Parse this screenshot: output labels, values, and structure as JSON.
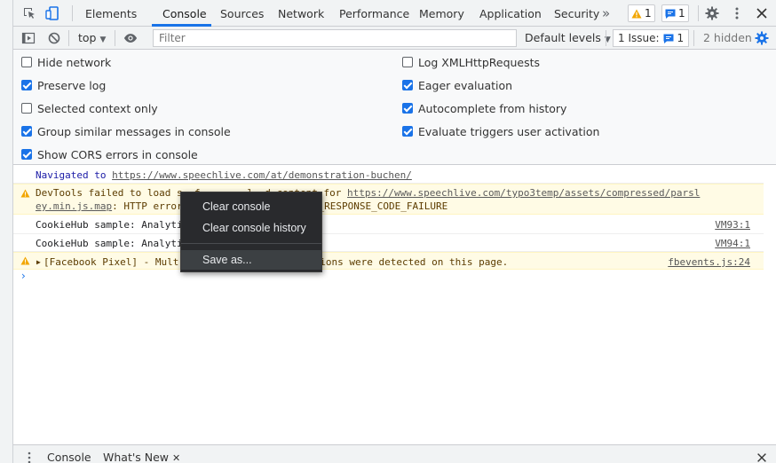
{
  "tabs": [
    {
      "label": "Elements"
    },
    {
      "label": "Console",
      "active": true
    },
    {
      "label": "Sources"
    },
    {
      "label": "Network"
    },
    {
      "label": "Performance"
    },
    {
      "label": "Memory"
    },
    {
      "label": "Application"
    },
    {
      "label": "Security"
    }
  ],
  "badges": {
    "warnings": "1",
    "messages": "1"
  },
  "toolbar": {
    "context": "top",
    "filter_placeholder": "Filter",
    "levels": "Default levels",
    "issues_label": "1 Issue:",
    "issues_count": "1",
    "hidden": "2 hidden"
  },
  "settings": {
    "left": [
      {
        "label": "Hide network",
        "checked": false
      },
      {
        "label": "Preserve log",
        "checked": true
      },
      {
        "label": "Selected context only",
        "checked": false
      },
      {
        "label": "Group similar messages in console",
        "checked": true
      },
      {
        "label": "Show CORS errors in console",
        "checked": true
      }
    ],
    "right": [
      {
        "label": "Log XMLHttpRequests",
        "checked": false
      },
      {
        "label": "Eager evaluation",
        "checked": true
      },
      {
        "label": "Autocomplete from history",
        "checked": true
      },
      {
        "label": "Evaluate triggers user activation",
        "checked": true
      }
    ]
  },
  "messages": {
    "nav_prefix": "Navigated to ",
    "nav_url": "https://www.speechlive.com/at/demonstration-buchen/",
    "devtools_line1_start": "DevTools failed to load s",
    "devtools_line1_mid": "  f        l  d content for ",
    "devtools_url_1": "https://www.speechlive.com/typo3temp/assets/compressed/parsl",
    "devtools_url_2": "ey.min.js.map",
    "devtools_line2_start": ": HTTP error",
    "devtools_line2_end": "ERR_HTTP_RESPONSE_CODE_FAILURE",
    "cookie1": "CookieHub sample: Analyti",
    "cookie1_src": "VM93:1",
    "cookie2": "CookieHub sample: Analyti",
    "cookie2_src": "VM94:1",
    "fb_start": "[Facebook Pixel] - Mult",
    "fb_end": "ing versions were detected on this page.",
    "fb_src": "fbevents.js:24",
    "prompt": "›"
  },
  "context_menu": {
    "items": [
      "Clear console",
      "Clear console history",
      "Save as..."
    ]
  },
  "drawer": {
    "tabs": [
      "Console",
      "What's New"
    ]
  },
  "colors": {
    "accent": "#1a73e8",
    "warning_bg": "#fffbe5",
    "menu_bg": "#292a2d"
  }
}
